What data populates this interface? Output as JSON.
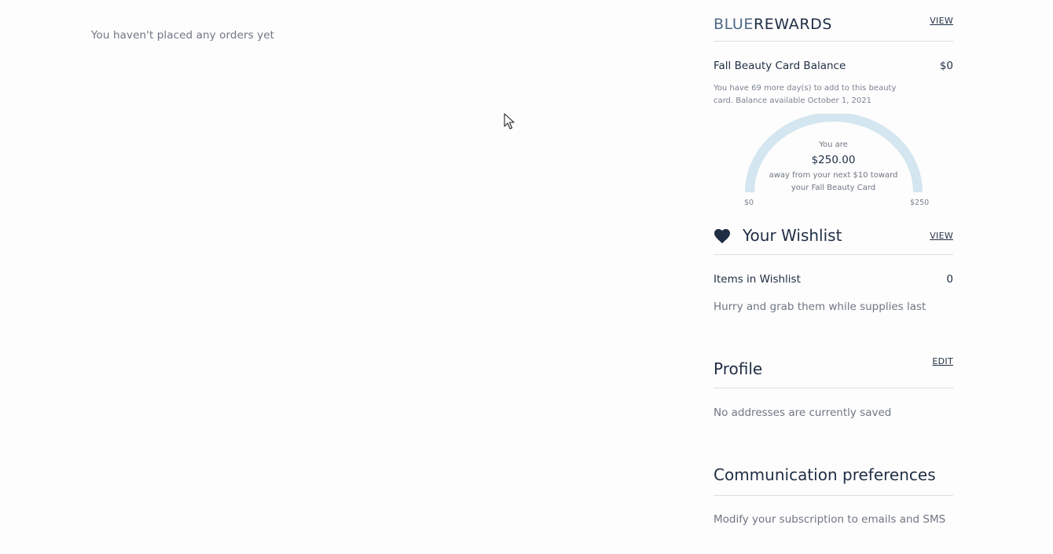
{
  "orders": {
    "empty_message": "You haven't placed any orders yet"
  },
  "rewards": {
    "title_blue": "BLUE",
    "title_rest": "REWARDS",
    "view_label": "VIEW",
    "balance_label": "Fall Beauty Card Balance",
    "balance_value": "$0",
    "note": "You have 69 more day(s) to add to this beauty card. Balance available October 1, 2021",
    "gauge": {
      "you_are": "You are",
      "amount": "$250.00",
      "line1": "away from your next $10 toward",
      "line2": "your Fall Beauty Card",
      "min_label": "$0",
      "max_label": "$250",
      "progress_fraction": 0,
      "track_color": "#d4e6ef"
    }
  },
  "wishlist": {
    "title": "Your Wishlist",
    "view_label": "VIEW",
    "icon": "heart-icon",
    "items_label": "Items in Wishlist",
    "items_count": "0",
    "hurry": "Hurry and grab them while supplies last"
  },
  "profile": {
    "title": "Profile",
    "edit_label": "EDIT",
    "no_addresses": "No addresses are currently saved"
  },
  "communication": {
    "title": "Communication preferences",
    "modify": "Modify your subscription to emails and SMS"
  },
  "colors": {
    "navy": "#1f2d44",
    "brand_blue": "#4f6786",
    "muted": "#6f7683"
  }
}
